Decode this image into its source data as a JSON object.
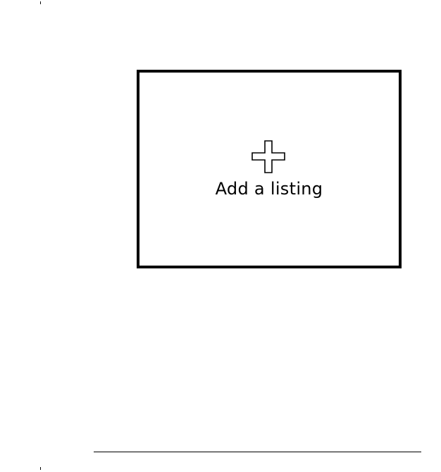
{
  "add_listing": {
    "label": "Add a listing",
    "icon": "plus-icon"
  },
  "colors": {
    "border": "#000000",
    "background": "#ffffff",
    "text": "#000000"
  }
}
